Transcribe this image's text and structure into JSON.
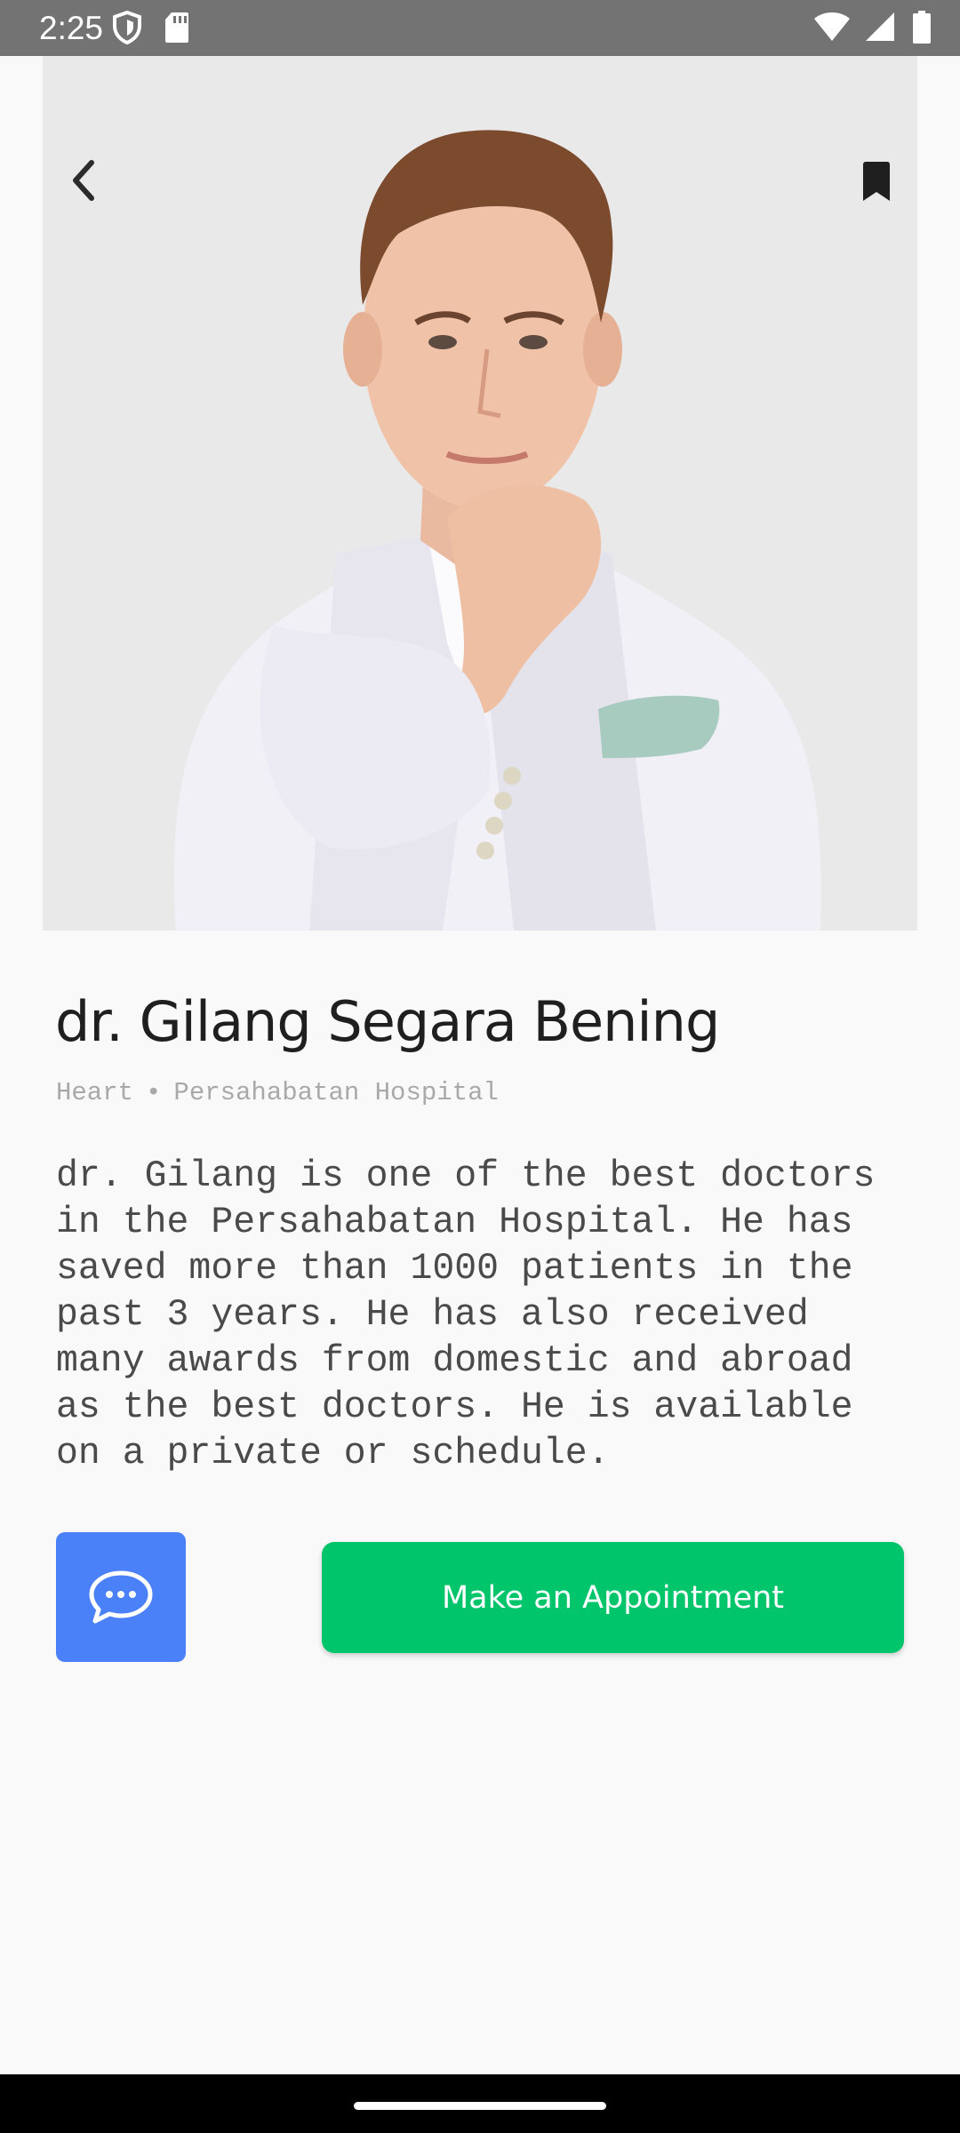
{
  "status_bar": {
    "time": "2:25",
    "icons": [
      "shield-icon",
      "sd-card-icon",
      "wifi-icon",
      "signal-icon",
      "battery-icon"
    ]
  },
  "header": {
    "icons": {
      "back": "chevron-left-icon",
      "bookmark": "bookmark-icon"
    },
    "image": "doctor-portrait"
  },
  "doctor": {
    "name": "dr. Gilang Segara Bening",
    "specialty": "Heart",
    "separator": "•",
    "hospital": "Persahabatan Hospital",
    "bio": "dr. Gilang is one of the best doctors in the Persahabatan Hospital. He has saved more than 1000 patients in the past 3 years. He has also received many awards from domestic and abroad as the best doctors. He is available on a private or schedule."
  },
  "actions": {
    "chat_icon": "chat-bubble-icon",
    "appointment_label": "Make an Appointment"
  },
  "colors": {
    "status_bar": "#737373",
    "background": "#f9f9f9",
    "chat_button": "#4a80f8",
    "appointment_button": "#00c56a",
    "nav_bar": "#000000"
  }
}
